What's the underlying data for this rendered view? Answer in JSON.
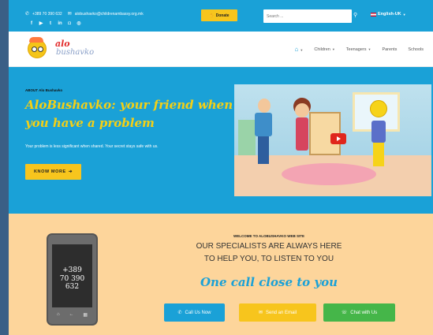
{
  "topbar": {
    "phone": "+389 70 390 632",
    "email": "alobushavko@childrenambassy.org.mk",
    "social_icons": [
      "facebook-icon",
      "youtube-icon",
      "twitter-icon",
      "linkedin-icon",
      "instagram-icon",
      "flickr-icon"
    ],
    "donate_label": "Donate",
    "search_placeholder": "Search ...",
    "language": "English-UK"
  },
  "logo": {
    "text_top": "alo",
    "text_bottom": "bushavko"
  },
  "nav": {
    "items": [
      {
        "label": "Children",
        "has_dropdown": true
      },
      {
        "label": "Teenagers",
        "has_dropdown": true
      },
      {
        "label": "Parents",
        "has_dropdown": false
      },
      {
        "label": "Schools",
        "has_dropdown": false
      }
    ]
  },
  "hero": {
    "eyebrow": "ABOUT Alo Bushavko",
    "title": "AloBushavko: your friend when you have a problem",
    "text": "Your problem is less significant when shared. Your secret stays safe with us.",
    "button_label": "KNOW MORE"
  },
  "phone_card": {
    "line1": "+389",
    "line2": "70 390 632"
  },
  "welcome": {
    "eyebrow": "WELCOME TO ALOBUSHAVKO WEB SITE",
    "line1": "OUR SPECIALISTS ARE ALWAYS HERE",
    "line2": "TO HELP YOU, TO LISTEN TO YOU",
    "tagline": "One call close to you",
    "buttons": {
      "call": "Call Us Now",
      "email": "Send an Email",
      "chat": "Chat with Us"
    }
  },
  "colors": {
    "primary_blue": "#1aa1d7",
    "accent_yellow": "#f7c51d",
    "section_orange": "#fdd59b",
    "chat_green": "#45b649"
  }
}
